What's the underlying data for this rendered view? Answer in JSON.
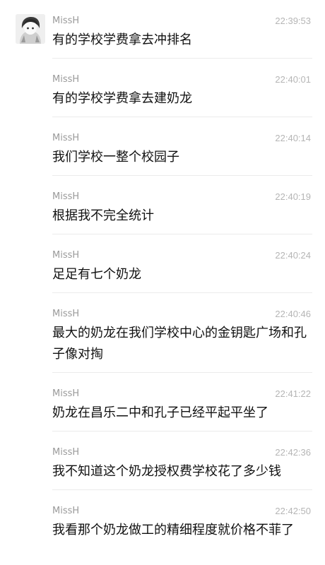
{
  "messages": [
    {
      "sender": "MissH",
      "time": "22:39:53",
      "text": "有的学校学费拿去冲排名"
    },
    {
      "sender": "MissH",
      "time": "22:40:01",
      "text": "有的学校学费拿去建奶龙"
    },
    {
      "sender": "MissH",
      "time": "22:40:14",
      "text": "我们学校一整个校园子"
    },
    {
      "sender": "MissH",
      "time": "22:40:19",
      "text": "根据我不完全统计"
    },
    {
      "sender": "MissH",
      "time": "22:40:24",
      "text": "足足有七个奶龙"
    },
    {
      "sender": "MissH",
      "time": "22:40:46",
      "text": "最大的奶龙在我们学校中心的金钥匙广场和孔子像对掏"
    },
    {
      "sender": "MissH",
      "time": "22:41:22",
      "text": "奶龙在昌乐二中和孔子已经平起平坐了"
    },
    {
      "sender": "MissH",
      "time": "22:42:36",
      "text": "我不知道这个奶龙授权费学校花了多少钱"
    },
    {
      "sender": "MissH",
      "time": "22:42:50",
      "text": "我看那个奶龙做工的精细程度就价格不菲了"
    }
  ]
}
